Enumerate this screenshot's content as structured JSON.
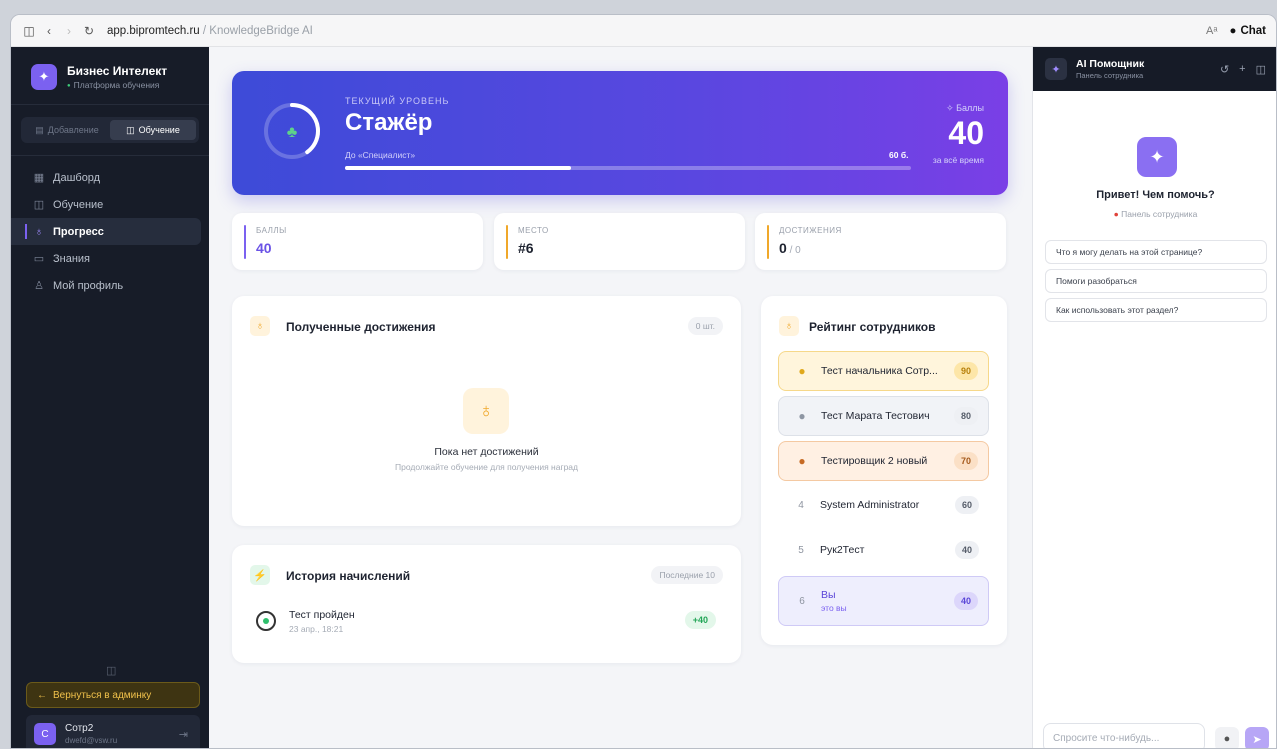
{
  "browser": {
    "domain": "app.bipromtech.ru",
    "path_sep": " / ",
    "page_title": "KnowledgeBridge AI",
    "chat_label": "Chat",
    "aa_label": "Aᵃ"
  },
  "sidebar": {
    "brand_title": "Бизнес Интелект",
    "brand_sub": "Платформа обучения",
    "modes": [
      {
        "label": "Добавление",
        "icon": "file-icon",
        "active": false
      },
      {
        "label": "Обучение",
        "icon": "book-icon",
        "active": true
      }
    ],
    "items": [
      {
        "label": "Дашборд",
        "icon": "dashboard-icon"
      },
      {
        "label": "Обучение",
        "icon": "book-icon"
      },
      {
        "label": "Прогресс",
        "icon": "award-icon",
        "active": true
      },
      {
        "label": "Знания",
        "icon": "folder-icon"
      },
      {
        "label": "Мой профиль",
        "icon": "user-icon"
      }
    ],
    "back_label": "Вернуться в админку",
    "user": {
      "initial": "С",
      "name": "Сотр2",
      "email": "dwefd@vsw.ru"
    }
  },
  "hero": {
    "caption": "ТЕКУЩИЙ УРОВЕНЬ",
    "level": "Стажёр",
    "next_level": "До «Специалист»",
    "points_needed": "60 б.",
    "progress": 0.4,
    "points_caption": "Баллы",
    "points": "40",
    "points_sub": "за всё время"
  },
  "stats": [
    {
      "caption": "БАЛЛЫ",
      "value": "40",
      "suffix": "",
      "color": "#7b61f0"
    },
    {
      "caption": "МЕСТО",
      "value": "#6",
      "suffix": "",
      "color": "#f0a82a"
    },
    {
      "caption": "ДОСТИЖЕНИЯ",
      "value": "0",
      "suffix": " / 0",
      "color": "#f0a82a"
    }
  ],
  "achievements": {
    "title": "Полученные достижения",
    "count": "0 шт.",
    "empty_title": "Пока нет достижений",
    "empty_sub": "Продолжайте обучение для получения наград"
  },
  "history": {
    "title": "История начислений",
    "badge": "Последние 10",
    "rows": [
      {
        "title": "Тест пройден",
        "date": "23 апр., 18:21",
        "points": "+40"
      }
    ]
  },
  "rating": {
    "title": "Рейтинг сотрудников",
    "rows": [
      {
        "pos": "1",
        "name": "Тест начальника Сотр...",
        "score": "90",
        "medal": "gold"
      },
      {
        "pos": "2",
        "name": "Тест Марата Тестович",
        "score": "80",
        "medal": "silver"
      },
      {
        "pos": "3",
        "name": "Тестировщик 2 новый",
        "score": "70",
        "medal": "bronze"
      },
      {
        "pos": "4",
        "name": "System Administrator",
        "score": "60",
        "medal": ""
      },
      {
        "pos": "5",
        "name": "Рук2Тест",
        "score": "40",
        "medal": ""
      },
      {
        "pos": "6",
        "name": "Вы",
        "sub": "это вы",
        "score": "40",
        "medal": "",
        "you": true
      }
    ]
  },
  "chat": {
    "title": "AI Помощник",
    "subtitle": "Панель сотрудника",
    "greeting": "Привет! Чем помочь?",
    "context": "Панель сотрудника",
    "suggestions": [
      "Что я могу делать на этой странице?",
      "Помоги разобраться",
      "Как использовать этот раздел?"
    ],
    "input_placeholder": "Спросите что-нибудь..."
  }
}
